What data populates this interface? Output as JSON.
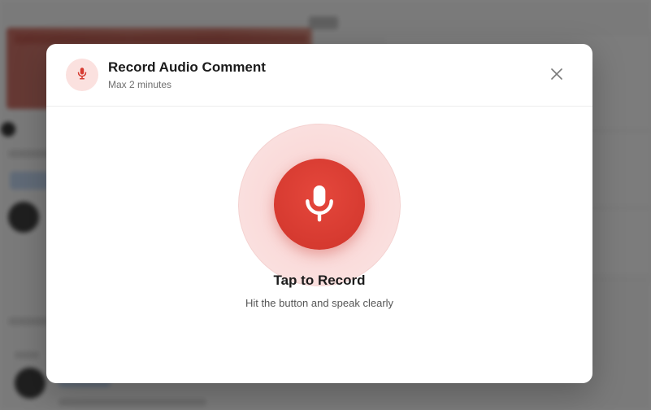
{
  "modal": {
    "title": "Record Audio Comment",
    "subtitle": "Max 2 minutes",
    "header_icon": "microphone-icon",
    "close_icon": "close-icon"
  },
  "recorder": {
    "button_icon": "microphone-icon",
    "label": "Tap to Record",
    "hint": "Hit the button and speak clearly"
  },
  "colors": {
    "accent": "#d63a30",
    "accent_soft": "#fbe1df",
    "overlay": "rgba(20,20,20,0.55)"
  }
}
